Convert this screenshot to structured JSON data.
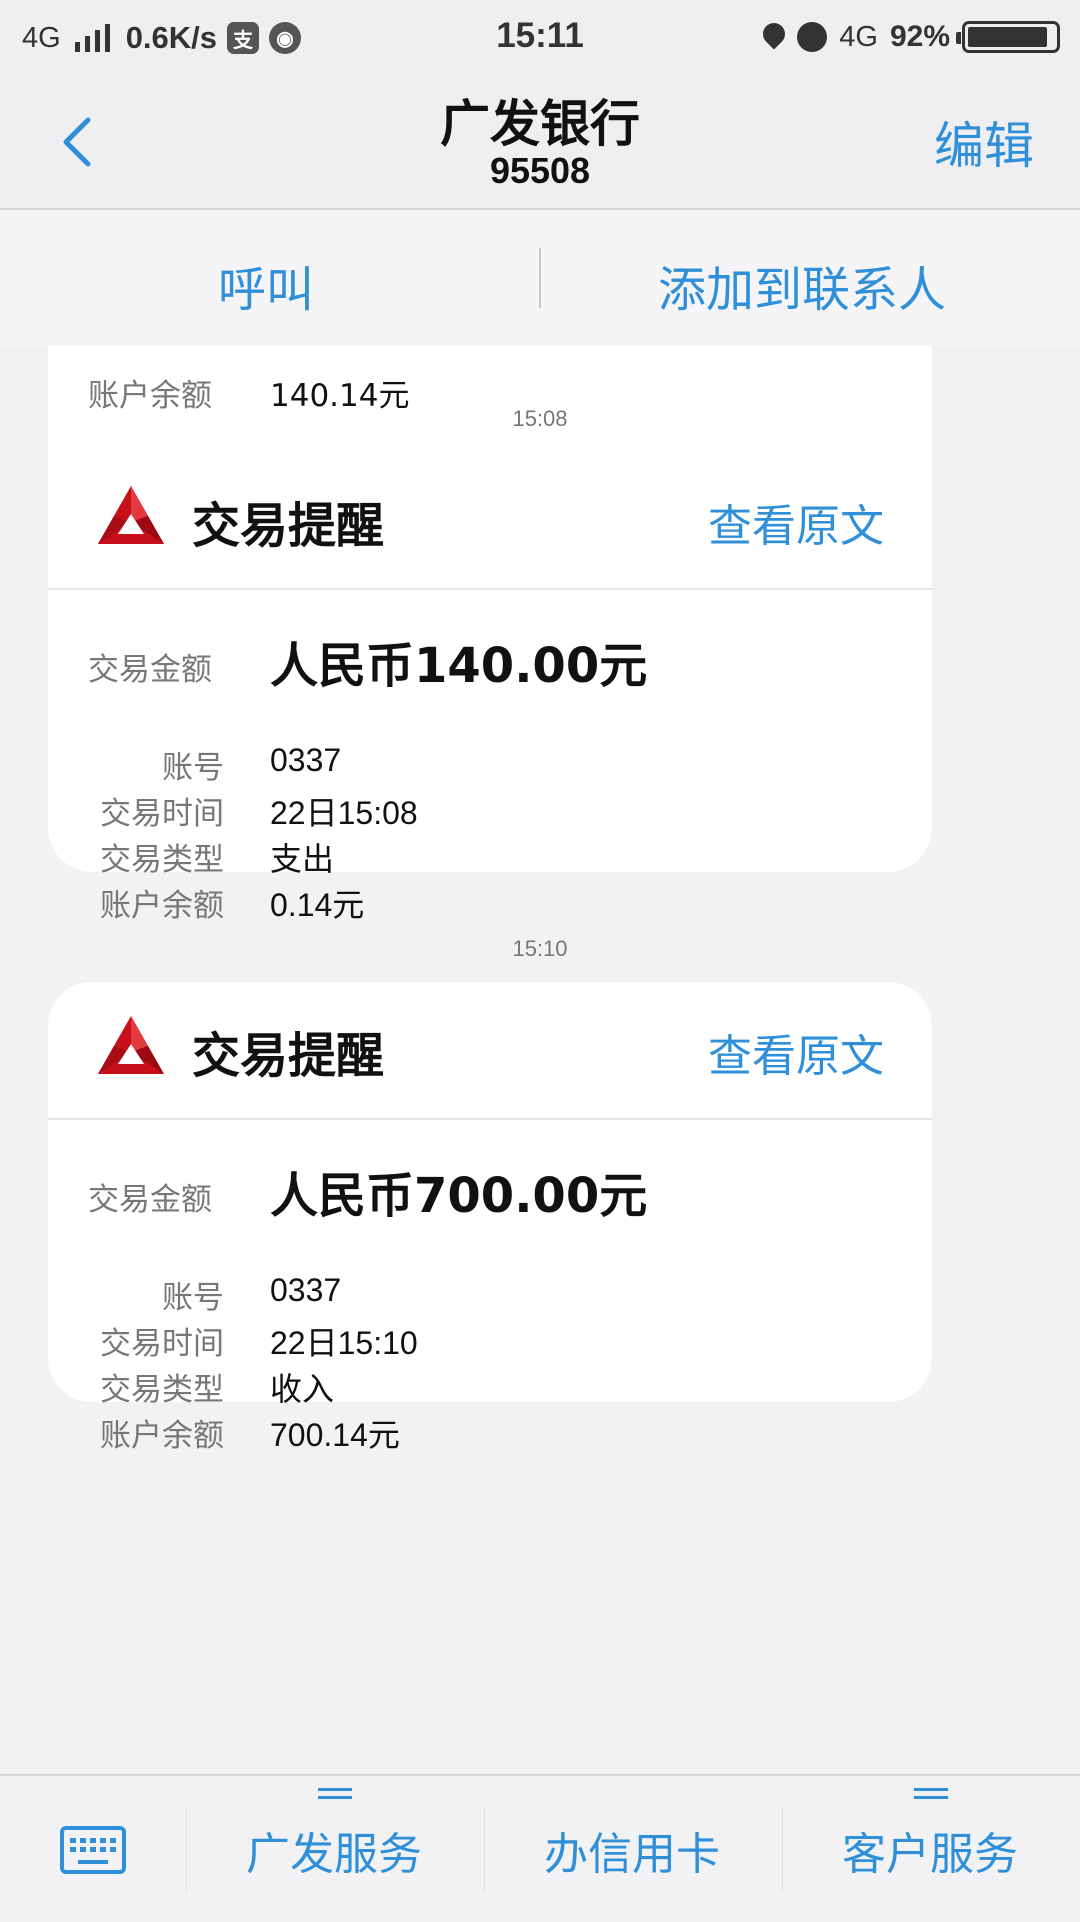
{
  "status_bar": {
    "network_left": "4G",
    "speed": "0.6K/s",
    "time": "15:11",
    "network_right": "4G",
    "battery": "92%",
    "battery_level": 0.92
  },
  "header": {
    "title": "广发银行",
    "subtitle": "95508",
    "edit_label": "编辑"
  },
  "actions": {
    "call_label": "呼叫",
    "add_contact_label": "添加到联系人"
  },
  "partial_message": {
    "label": "账户余额",
    "value": "140.14元"
  },
  "messages": [
    {
      "timestamp": "15:08",
      "title": "交易提醒",
      "view_label": "查看原文",
      "amount_label": "交易金额",
      "amount": "人民币140.00元",
      "fields": [
        {
          "label": "账号",
          "value": "0337"
        },
        {
          "label": "交易时间",
          "value": "22日15:08"
        },
        {
          "label": "交易类型",
          "value": "支出"
        },
        {
          "label": "账户余额",
          "value": "0.14元"
        }
      ]
    },
    {
      "timestamp": "15:10",
      "title": "交易提醒",
      "view_label": "查看原文",
      "amount_label": "交易金额",
      "amount": "人民币700.00元",
      "fields": [
        {
          "label": "账号",
          "value": "0337"
        },
        {
          "label": "交易时间",
          "value": "22日15:10"
        },
        {
          "label": "交易类型",
          "value": "收入"
        },
        {
          "label": "账户余额",
          "value": "700.14元"
        }
      ]
    }
  ],
  "bottom_bar": {
    "tabs": [
      {
        "label": "广发服务"
      },
      {
        "label": "办信用卡"
      },
      {
        "label": "客户服务"
      }
    ]
  },
  "colors": {
    "accent": "#2f8fd8",
    "logo_red": "#c8101a",
    "background": "#f2f2f4"
  },
  "icons": [
    "signal-icon",
    "alipay-icon",
    "compass-icon",
    "location-icon",
    "alarm-icon",
    "battery-icon",
    "back-chevron-icon",
    "bank-logo-icon",
    "keyboard-icon",
    "menu-lines-icon"
  ]
}
